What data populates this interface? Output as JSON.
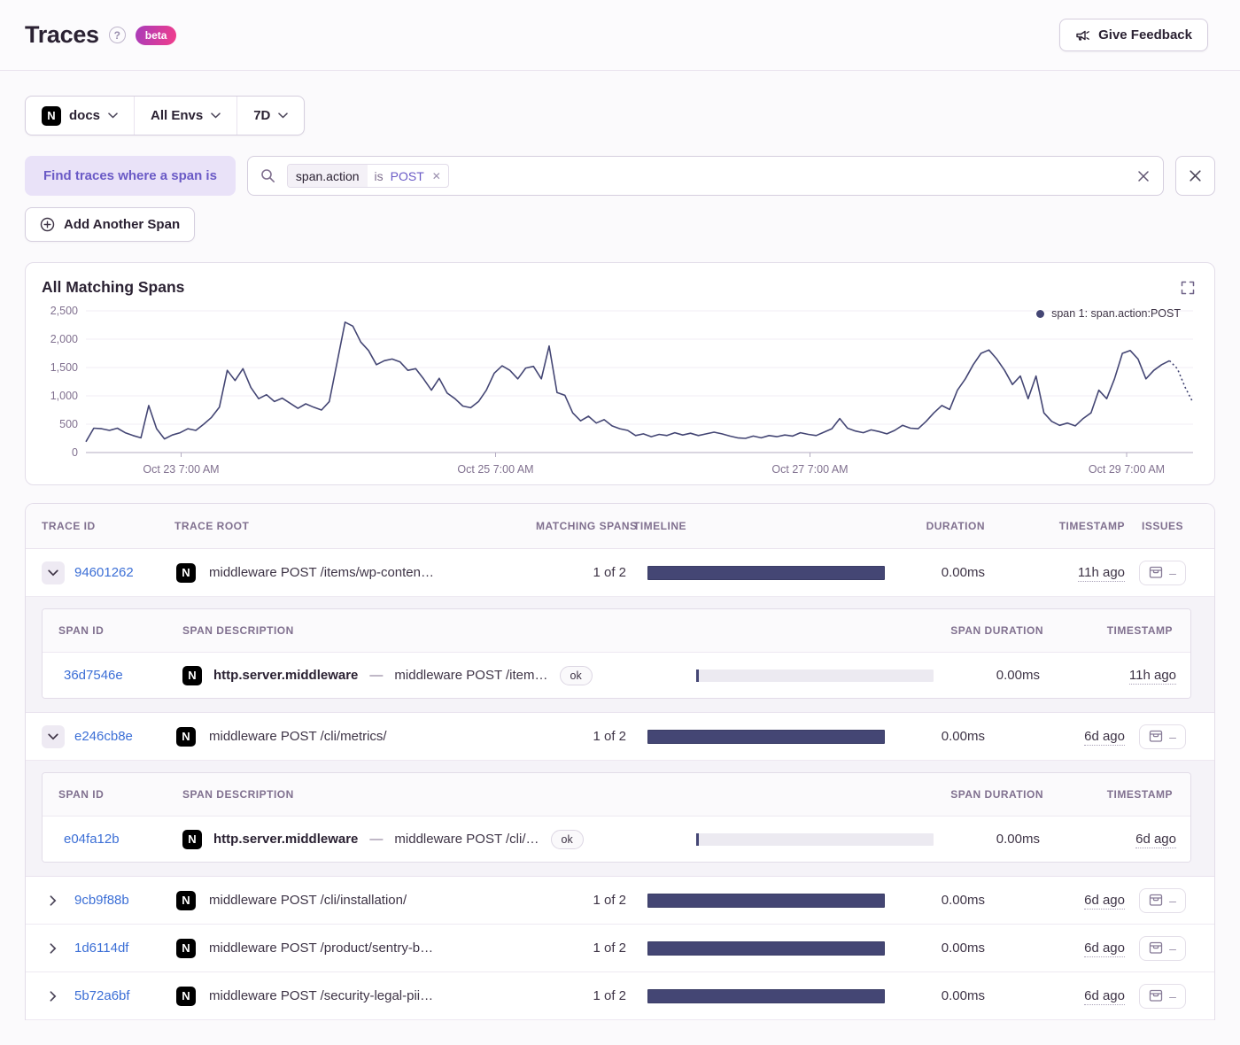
{
  "header": {
    "title": "Traces",
    "beta_label": "beta",
    "feedback_button": "Give Feedback"
  },
  "colors": {
    "accent_purple": "#6a5ac6",
    "link_blue": "#3c6fd6",
    "series_color": "#444674",
    "beta_gradient_start": "#a83cba",
    "beta_gradient_end": "#f23d8b",
    "where_pill_bg": "#e9e2f8"
  },
  "filter_bar": {
    "project": "docs",
    "project_platform_initial": "N",
    "environment": "All Envs",
    "date_range": "7D"
  },
  "span_search": {
    "where_label": "Find traces where a span is",
    "token": {
      "key": "span.action",
      "operator": "is",
      "value": "POST",
      "remove": "✕"
    },
    "add_span_button": "Add Another Span"
  },
  "chart": {
    "title": "All Matching Spans",
    "legend": "span 1: span.action:POST"
  },
  "chart_data": {
    "type": "line",
    "title": "All Matching Spans",
    "series": [
      {
        "name": "span 1: span.action:POST",
        "color": "#444674",
        "values": [
          190,
          430,
          420,
          390,
          430,
          350,
          300,
          260,
          830,
          420,
          240,
          310,
          350,
          420,
          390,
          500,
          620,
          800,
          1450,
          1270,
          1480,
          1150,
          950,
          1020,
          900,
          960,
          870,
          780,
          860,
          800,
          750,
          900,
          1600,
          2300,
          2230,
          1950,
          1800,
          1550,
          1620,
          1650,
          1600,
          1450,
          1480,
          1300,
          1100,
          1310,
          1050,
          950,
          820,
          790,
          900,
          1100,
          1400,
          1530,
          1450,
          1300,
          1490,
          1520,
          1300,
          1880,
          1060,
          1010,
          700,
          560,
          640,
          520,
          580,
          470,
          420,
          390,
          300,
          330,
          280,
          320,
          300,
          350,
          310,
          340,
          300,
          330,
          360,
          330,
          290,
          260,
          250,
          290,
          260,
          300,
          280,
          310,
          290,
          350,
          320,
          300,
          360,
          420,
          600,
          430,
          380,
          350,
          400,
          370,
          330,
          390,
          480,
          430,
          420,
          550,
          700,
          830,
          760,
          1100,
          1300,
          1550,
          1750,
          1810,
          1650,
          1450,
          1200,
          1350,
          950,
          1350,
          700,
          550,
          480,
          520,
          470,
          600,
          700,
          1100,
          950,
          1300,
          1750,
          1800,
          1650,
          1300,
          1450,
          1550,
          1620,
          1480,
          1150,
          880
        ]
      }
    ],
    "dashed_tail_points": 3,
    "y_ticks": [
      0,
      500,
      1000,
      1500,
      2000,
      2500
    ],
    "ylim": [
      0,
      2500
    ],
    "x_tick_labels": [
      "Oct 23 7:00 AM",
      "Oct 25 7:00 AM",
      "Oct 27 7:00 AM",
      "Oct 29 7:00 AM"
    ],
    "x_tick_fractions": [
      0.086,
      0.37,
      0.654,
      0.94
    ],
    "grid": true,
    "legend_position": "top-right"
  },
  "table": {
    "platform_initial": "N",
    "columns": [
      "TRACE ID",
      "TRACE ROOT",
      "MATCHING SPANS",
      "TIMELINE",
      "DURATION",
      "TIMESTAMP",
      "ISSUES"
    ],
    "span_columns": [
      "SPAN ID",
      "SPAN DESCRIPTION",
      "SPAN DURATION",
      "TIMESTAMP"
    ],
    "rows": [
      {
        "trace_id": "94601262",
        "root": "middleware POST /items/wp-conten…",
        "matching_spans": "1 of 2",
        "duration": "0.00ms",
        "timestamp": "11h ago",
        "issues": "–",
        "expanded": true,
        "spans": [
          {
            "span_id": "36d7546e",
            "operation": "http.server.middleware",
            "separator": "—",
            "description": "middleware POST /item…",
            "status": "ok",
            "duration": "0.00ms",
            "timestamp": "11h ago"
          }
        ]
      },
      {
        "trace_id": "e246cb8e",
        "root": "middleware POST /cli/metrics/",
        "matching_spans": "1 of 2",
        "duration": "0.00ms",
        "timestamp": "6d ago",
        "issues": "–",
        "expanded": true,
        "spans": [
          {
            "span_id": "e04fa12b",
            "operation": "http.server.middleware",
            "separator": "—",
            "description": "middleware POST /cli/…",
            "status": "ok",
            "duration": "0.00ms",
            "timestamp": "6d ago"
          }
        ]
      },
      {
        "trace_id": "9cb9f88b",
        "root": "middleware POST /cli/installation/",
        "matching_spans": "1 of 2",
        "duration": "0.00ms",
        "timestamp": "6d ago",
        "issues": "–",
        "expanded": false
      },
      {
        "trace_id": "1d6114df",
        "root": "middleware POST /product/sentry-b…",
        "matching_spans": "1 of 2",
        "duration": "0.00ms",
        "timestamp": "6d ago",
        "issues": "–",
        "expanded": false
      },
      {
        "trace_id": "5b72a6bf",
        "root": "middleware POST /security-legal-pii…",
        "matching_spans": "1 of 2",
        "duration": "0.00ms",
        "timestamp": "6d ago",
        "issues": "–",
        "expanded": false
      }
    ]
  }
}
